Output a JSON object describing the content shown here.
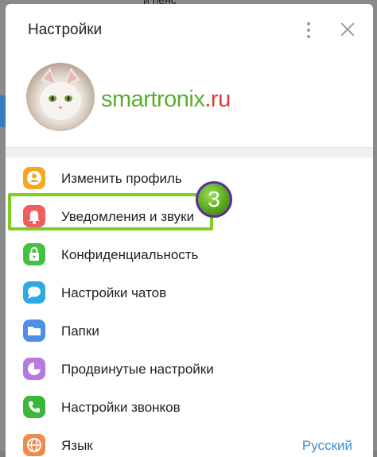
{
  "background": {
    "top_text": "и пенс"
  },
  "header": {
    "title": "Настройки"
  },
  "profile": {
    "brand_part1": "smartronix",
    "brand_part2": ".ru"
  },
  "menu": {
    "items": [
      {
        "label": "Изменить профиль",
        "color": "#f5a623",
        "icon": "person-icon"
      },
      {
        "label": "Уведомления и звуки",
        "color": "#ee5e5e",
        "icon": "bell-icon"
      },
      {
        "label": "Конфиденциальность",
        "color": "#42c242",
        "icon": "lock-icon"
      },
      {
        "label": "Настройки чатов",
        "color": "#2fa9e6",
        "icon": "chat-bubble-icon"
      },
      {
        "label": "Папки",
        "color": "#4f8ee8",
        "icon": "folder-icon"
      },
      {
        "label": "Продвинутые настройки",
        "color": "#b47ae0",
        "icon": "pie-chart-icon"
      },
      {
        "label": "Настройки звонков",
        "color": "#3bb83b",
        "icon": "phone-icon"
      },
      {
        "label": "Язык",
        "value": "Русский",
        "color": "#f08a4b",
        "icon": "globe-icon"
      }
    ]
  },
  "annotation": {
    "step": "3",
    "highlight_color": "#7fce1f"
  }
}
